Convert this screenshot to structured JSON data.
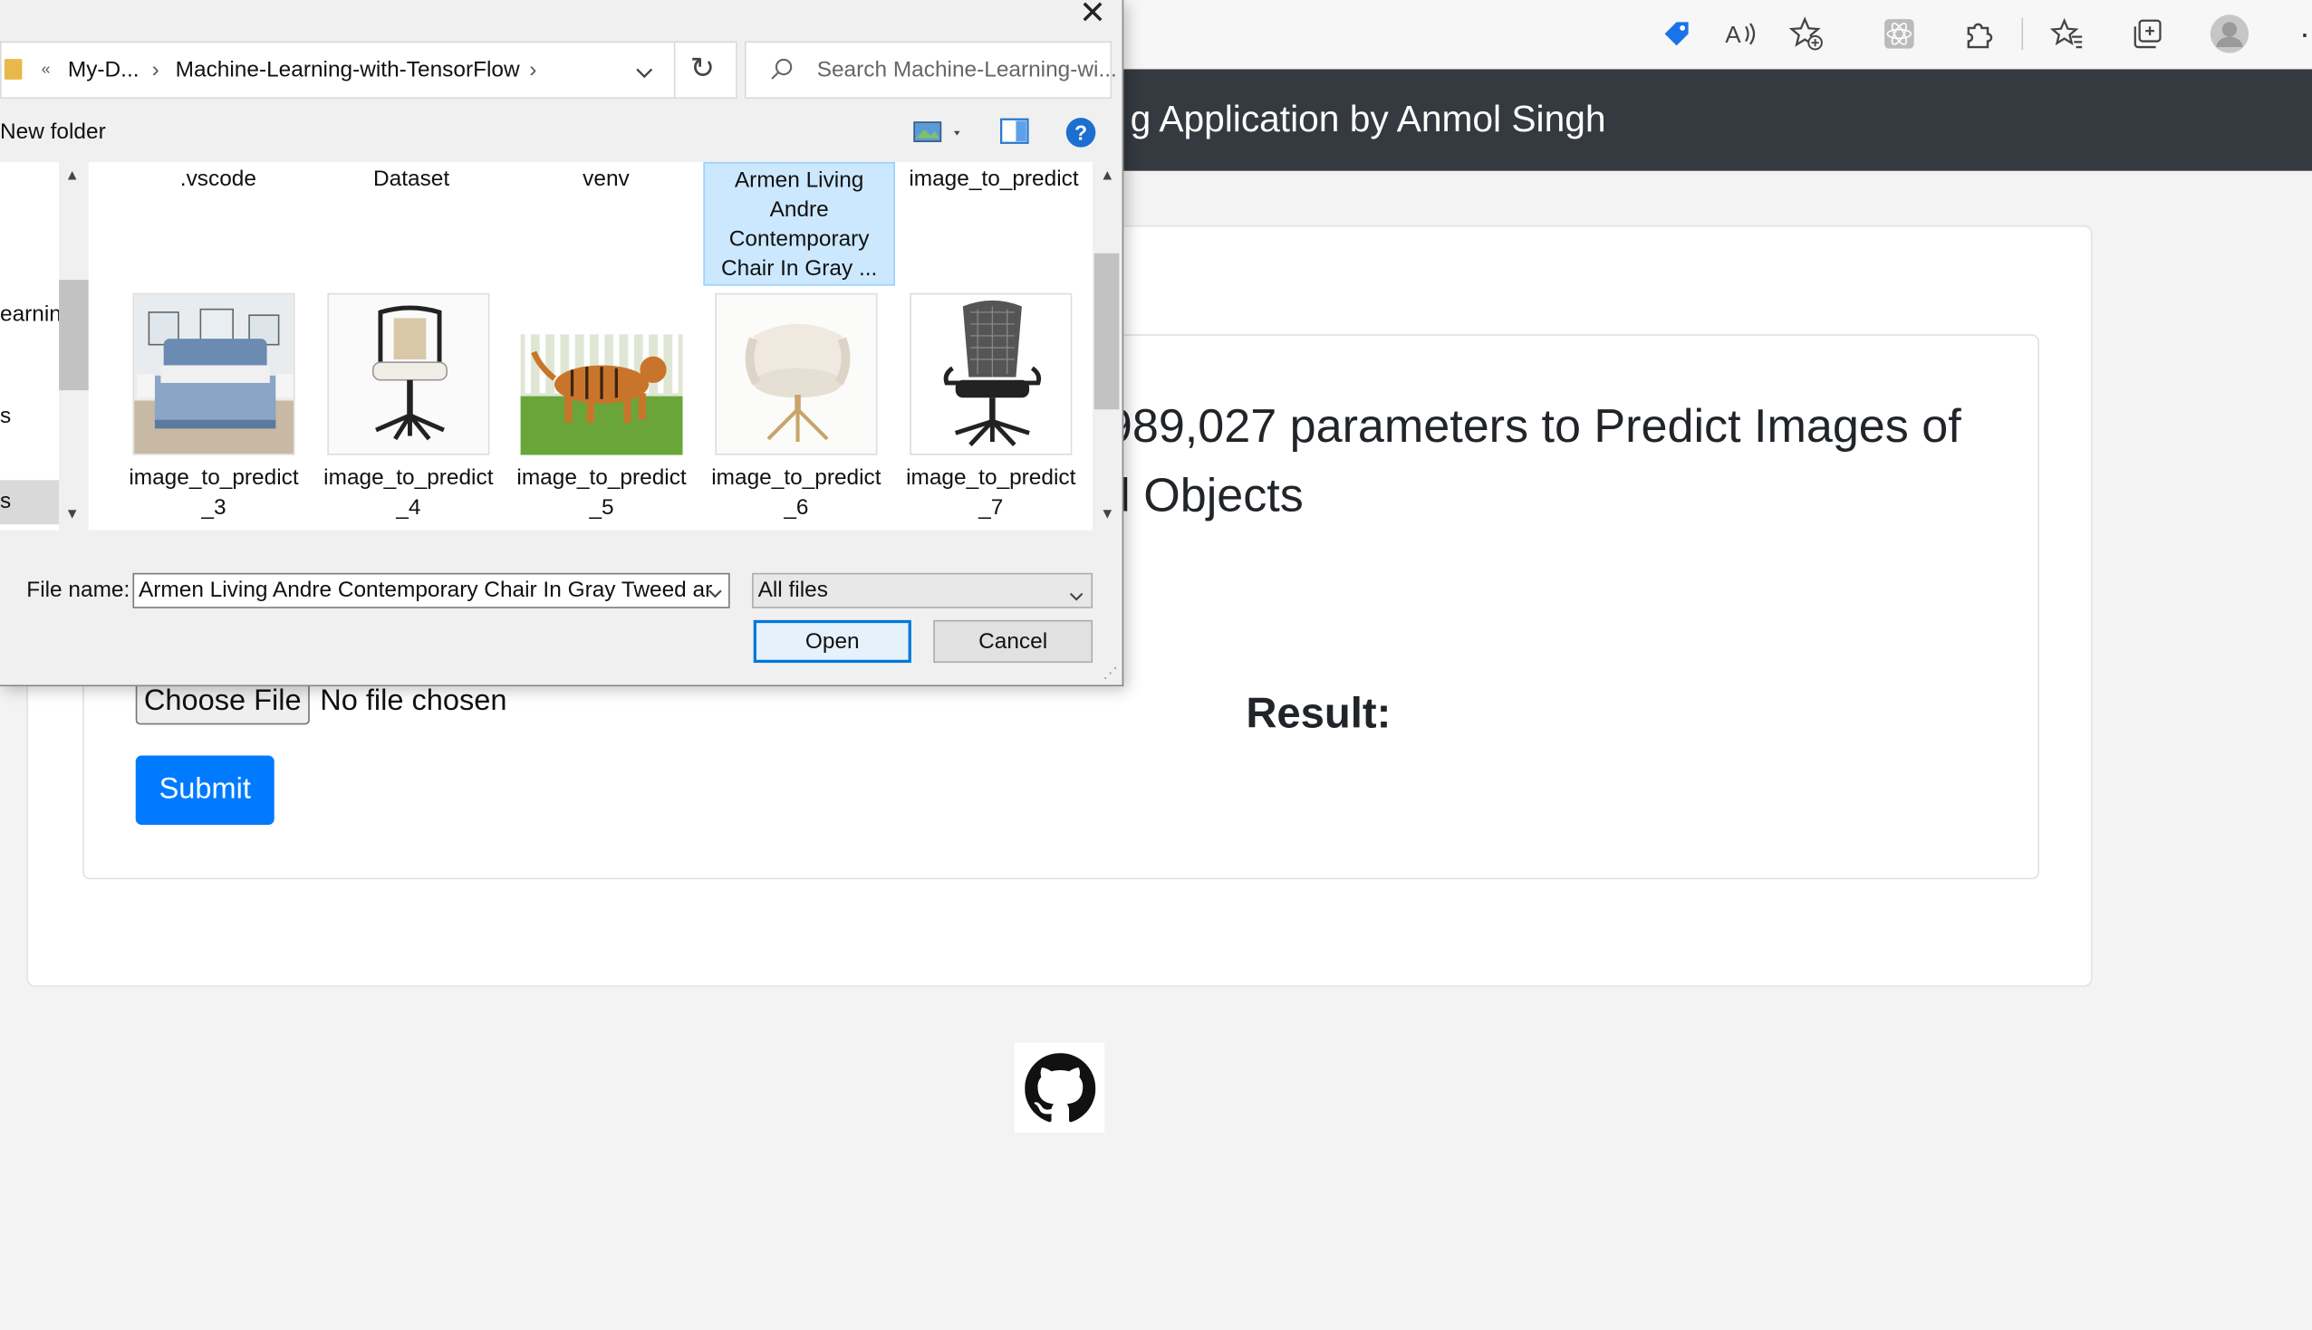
{
  "browser": {
    "more_label": "·"
  },
  "page": {
    "navbar_title": "g Application by Anmol Singh",
    "heading_line1": "989,027 parameters to Predict Images of",
    "heading_line2": "d Objects",
    "choose_file_label": "Choose File",
    "no_file_text": "No file chosen",
    "result_label": "Result:",
    "submit_label": "Submit"
  },
  "dialog": {
    "close_glyph": "✕",
    "breadcrumb": {
      "overflow": "«",
      "parent": "My-D...",
      "current": "Machine-Learning-with-TensorFlow",
      "separator": "›"
    },
    "refresh_glyph": "↻",
    "search_placeholder": "Search Machine-Learning-wi...",
    "new_folder_label": "New folder",
    "help_glyph": "?",
    "nav_items": [
      "earnin",
      "s",
      "s"
    ],
    "folders": [
      {
        "name": ".vscode"
      },
      {
        "name": "Dataset"
      },
      {
        "name": "venv"
      },
      {
        "name": "Armen Living Andre Contemporary Chair In Gray ...",
        "lines": [
          "Armen Living",
          "Andre",
          "Contemporary",
          "Chair In Gray ..."
        ],
        "selected": true
      },
      {
        "name": "image_to_predict"
      }
    ],
    "images": [
      {
        "line1": "image_to_predict",
        "line2": "_3",
        "icon": "bed-image-icon"
      },
      {
        "line1": "image_to_predict",
        "line2": "_4",
        "icon": "office-chair-image-icon"
      },
      {
        "line1": "image_to_predict",
        "line2": "_5",
        "icon": "tiger-dog-image-icon"
      },
      {
        "line1": "image_to_predict",
        "line2": "_6",
        "icon": "armchair-image-icon"
      },
      {
        "line1": "image_to_predict",
        "line2": "_7",
        "icon": "mesh-chair-image-icon"
      }
    ],
    "file_name_label": "File name:",
    "file_name_value": "Armen Living Andre Contemporary Chair In Gray Tweed ar",
    "filter_value": "All files",
    "open_label": "Open",
    "cancel_label": "Cancel"
  },
  "colors": {
    "navbar_bg": "#343a40",
    "submit_bg": "#007bff",
    "selection_bg": "#cce8ff",
    "open_border": "#0078d7"
  }
}
